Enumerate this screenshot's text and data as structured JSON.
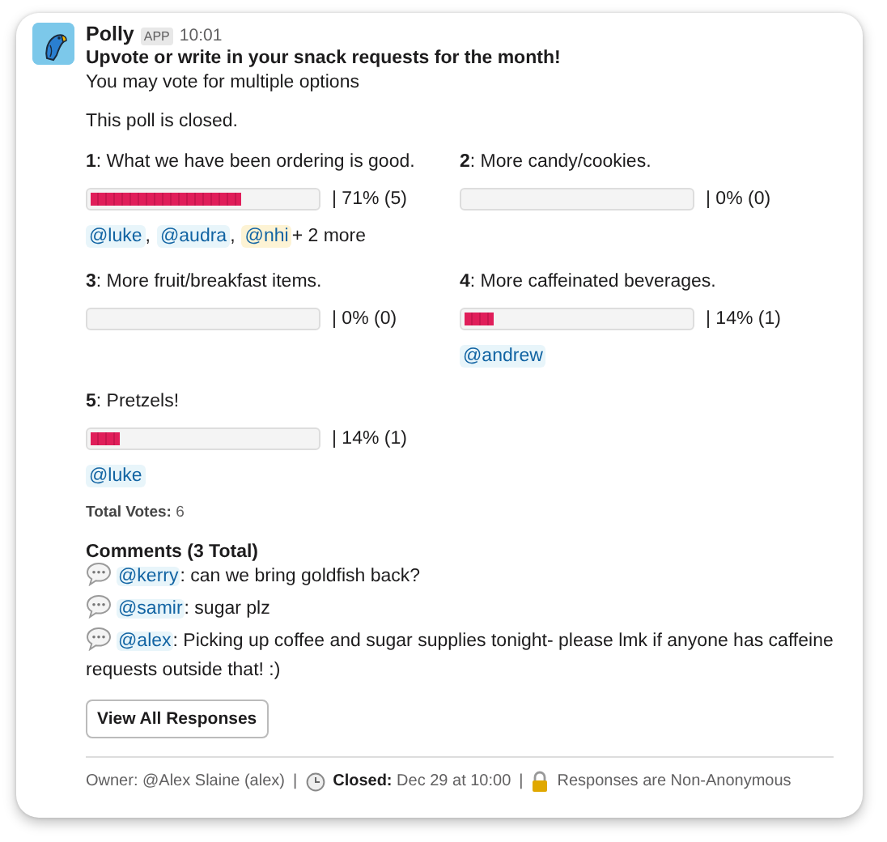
{
  "message": {
    "sender": "Polly",
    "badge": "APP",
    "time": "10:01",
    "title": "Upvote or write in your snack requests for the month!",
    "subtitle": "You may vote for multiple options",
    "status": "This poll is closed."
  },
  "options": [
    {
      "label": "**1**: What we have been ordering is good.",
      "level": 0.67,
      "result": "| 71% (5)",
      "voters": [
        {
          "kind": "mention",
          "text": "@luke",
          "self": false
        },
        {
          "kind": "text",
          "text": ","
        },
        {
          "kind": "mention",
          "text": "@audra",
          "self": false
        },
        {
          "kind": "text",
          "text": ","
        },
        {
          "kind": "mention",
          "text": "@nhi",
          "self": true
        },
        {
          "kind": "text",
          "text": "+ 2 more"
        }
      ]
    },
    {
      "label": "**2**: More candy/cookies.",
      "result": "| 0% (0)"
    },
    {
      "label": "**3**: More fruit/breakfast items.",
      "result": "| 0% (0)"
    },
    {
      "label": "**4**: More caffeinated beverages.",
      "level": 0.13,
      "result": "| 14% (1)",
      "voters": [
        {
          "kind": "mention",
          "text": "@andrew",
          "self": false
        }
      ]
    },
    {
      "label": "**5**: Pretzels!",
      "level": 0.13,
      "result": "| 14% (1)",
      "voters": [
        {
          "kind": "mention",
          "text": "@luke",
          "self": false
        }
      ]
    }
  ],
  "total_votes": "**Total Votes:** 6",
  "comments": {
    "title": "Comments (3 Total)",
    "items": [
      {
        "mention": "@kerry",
        "text": ": can we bring goldfish back?"
      },
      {
        "mention": "@samir",
        "text": ": sugar plz"
      },
      {
        "mention": "@alex",
        "text": ": Picking up coffee and sugar supplies tonight- please lmk if anyone has caffeine requests outside that! :)"
      }
    ]
  },
  "button": "View All Responses",
  "footer": [
    {
      "kind": "text",
      "text": "Owner: @Alex Slaine (alex)"
    },
    {
      "kind": "separator",
      "text": "|"
    },
    {
      "kind": "closed",
      "text": "**Closed:** Dec 29 at 10:00"
    },
    {
      "kind": "separator",
      "text": "|"
    },
    {
      "kind": "lock",
      "text": "Responses are Non-Anonymous"
    }
  ]
}
